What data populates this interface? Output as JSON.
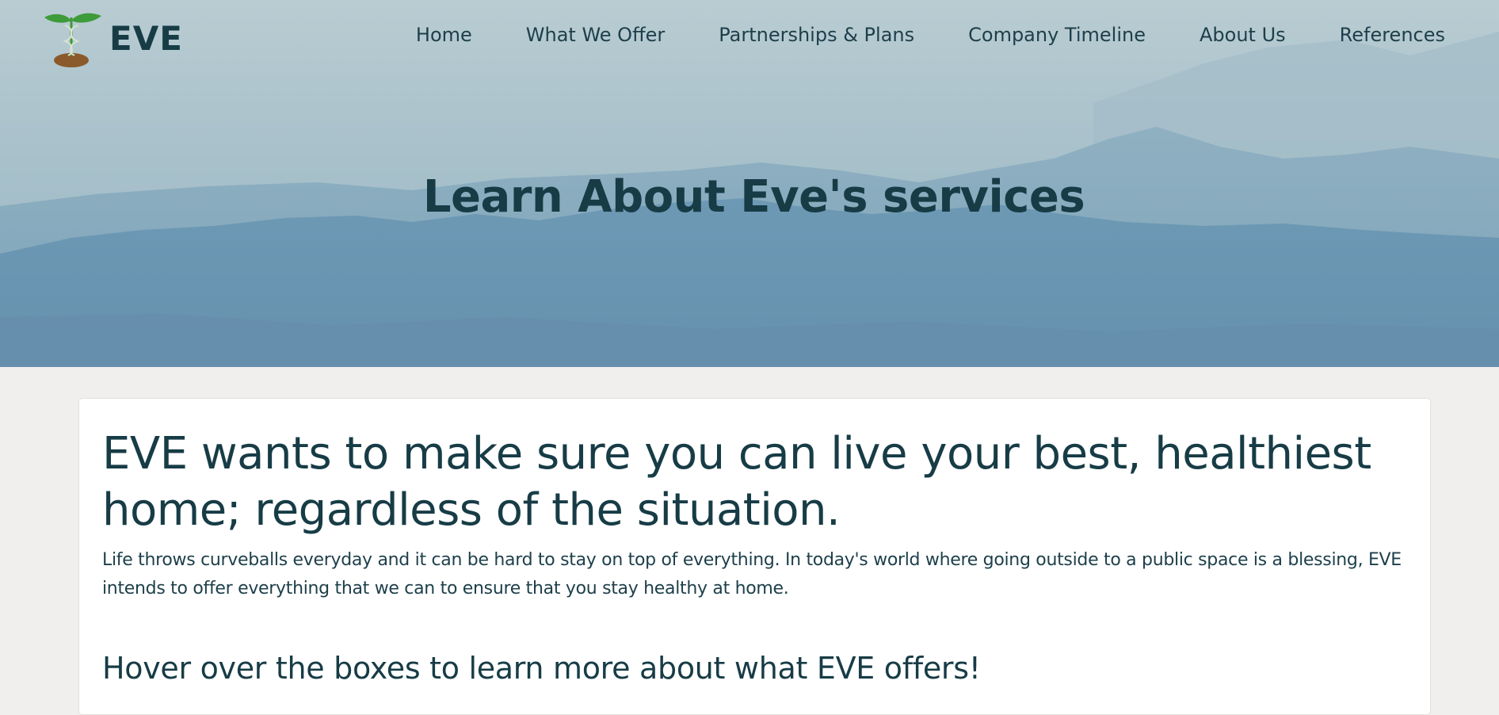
{
  "brand": {
    "name": "EVE",
    "logo_icon": "sprout-caduceus-icon"
  },
  "nav": {
    "items": [
      {
        "label": "Home"
      },
      {
        "label": "What We Offer"
      },
      {
        "label": "Partnerships & Plans"
      },
      {
        "label": "Company Timeline"
      },
      {
        "label": "About Us"
      },
      {
        "label": "References"
      }
    ]
  },
  "hero": {
    "title": "Learn About Eve's services"
  },
  "intro": {
    "heading": "EVE wants to make sure you can live your best, healthiest home; regardless of the situation.",
    "body": "Life throws curveballs everyday and it can be hard to stay on top of everything. In today's world where going outside to a public space is a blessing, EVE intends to offer everything that we can to ensure that you stay healthy at home.",
    "subheading": "Hover over the boxes to learn more about what EVE offers!"
  },
  "colors": {
    "text_dark": "#173c46",
    "page_bg": "#f1efee",
    "card_bg": "#ffffff",
    "logo_leaf": "#3e9b3a",
    "logo_soil": "#8a5a2b"
  }
}
